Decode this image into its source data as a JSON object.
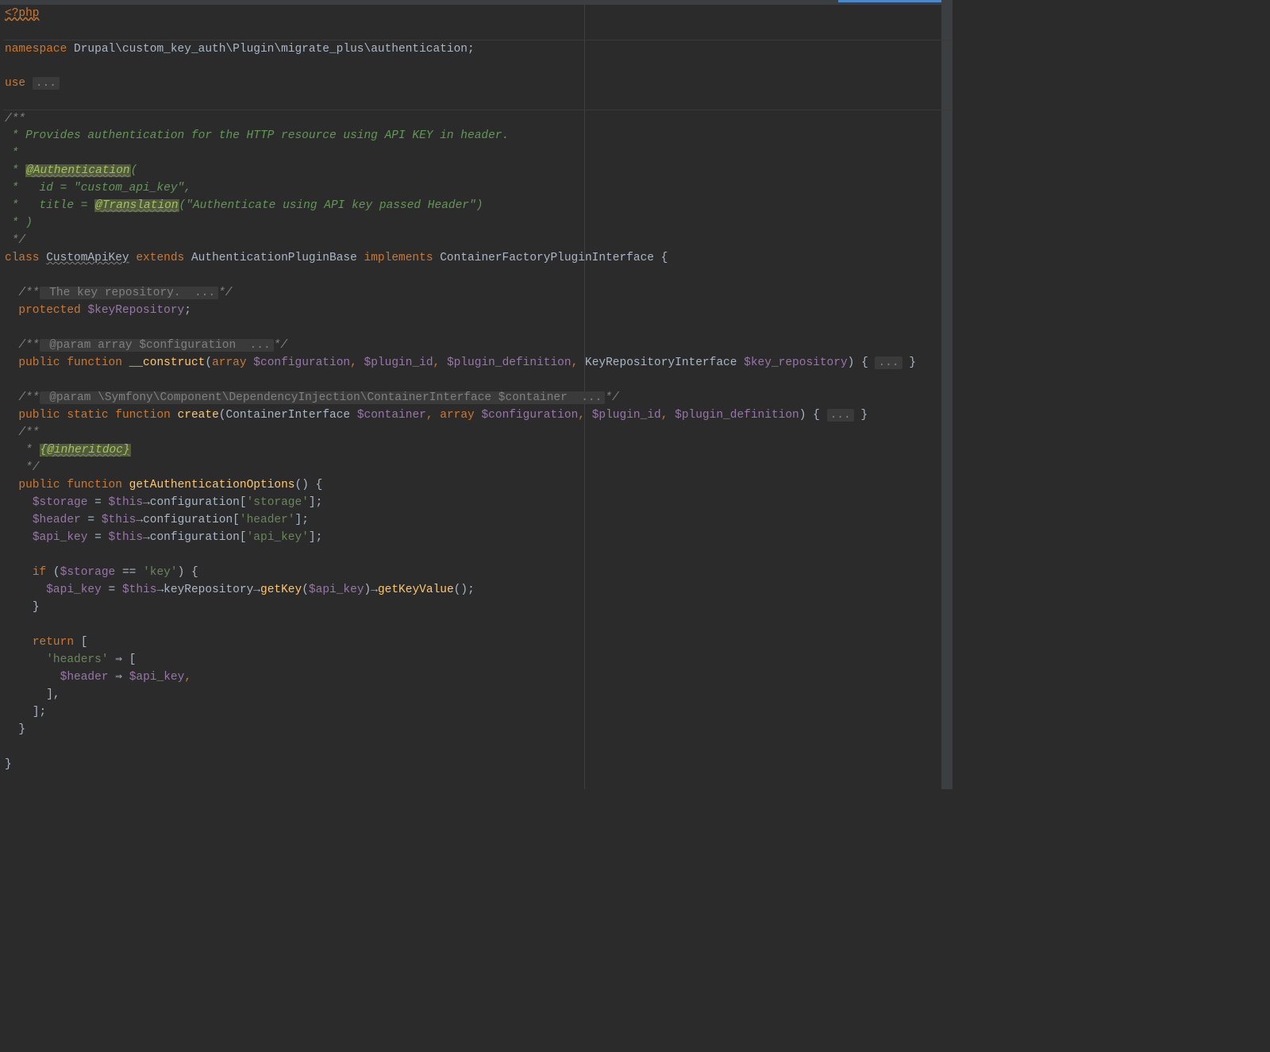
{
  "lines": {
    "l1": "<?php",
    "l2_namespace": "namespace",
    "l2_ns": " Drupal\\custom_key_auth\\Plugin\\migrate_plus\\authentication;",
    "l3_use": "use",
    "l3_dots": "...",
    "l4": "/**",
    "l5": " * Provides authentication for the HTTP resource using API KEY in header.",
    "l6": " *",
    "l7a": " * ",
    "l7b": "@Authentication",
    "l7c": "(",
    "l8a": " *   id = ",
    "l8b": "\"custom_api_key\"",
    "l8c": ",",
    "l9a": " *   title = ",
    "l9b": "@Translation",
    "l9c": "(",
    "l9d": "\"Authenticate using API key passed Header\"",
    "l9e": ")",
    "l10": " * )",
    "l11": " */",
    "l12_class": "class",
    "l12_name": "CustomApiKey",
    "l12_extends": "extends",
    "l12_base": "AuthenticationPluginBase",
    "l12_impl": "implements",
    "l12_iface": "ContainerFactoryPluginInterface {",
    "l13a": "/**",
    "l13b": " The key repository.  ...",
    "l13c": "*/",
    "l14_protected": "protected",
    "l14_var": "$keyRepository",
    "l14_semi": ";",
    "l15a": "/**",
    "l15b": " @param array $configuration  ...",
    "l15c": "*/",
    "l16_public": "public",
    "l16_function": "function",
    "l16_name": "__construct",
    "l16_p1": "(",
    "l16_array": "array",
    "l16_v1": "$configuration",
    "l16_c1": ",",
    "l16_v2": "$plugin_id",
    "l16_c2": ",",
    "l16_v3": "$plugin_definition",
    "l16_c3": ",",
    "l16_t4": "KeyRepositoryInterface",
    "l16_v4": "$key_repository",
    "l16_p2": ") {",
    "l16_dots": "...",
    "l16_close": "}",
    "l17a": "/**",
    "l17b": " @param \\Symfony\\Component\\DependencyInjection\\ContainerInterface $container  ...",
    "l17c": "*/",
    "l18_public": "public",
    "l18_static": "static",
    "l18_function": "function",
    "l18_name": "create",
    "l18_p1": "(ContainerInterface",
    "l18_v1": "$container",
    "l18_c1": ",",
    "l18_array": "array",
    "l18_v2": "$configuration",
    "l18_c2": ",",
    "l18_v3": "$plugin_id",
    "l18_c3": ",",
    "l18_v4": "$plugin_definition",
    "l18_p2": ") {",
    "l18_dots": "...",
    "l18_close": "}",
    "l19": "/**",
    "l20a": " * ",
    "l20b": "{@inheritdoc}",
    "l21": " */",
    "l22_public": "public",
    "l22_function": "function",
    "l22_name": "getAuthenticationOptions",
    "l22_rest": "() {",
    "l23_var": "$storage",
    "l23_eq": " = ",
    "l23_this": "$this",
    "l23_arrow": "→",
    "l23_prop": "configuration[",
    "l23_key": "'storage'",
    "l23_close": "];",
    "l24_var": "$header",
    "l24_key": "'header'",
    "l25_var": "$api_key",
    "l25_key": "'api_key'",
    "l27_if": "if",
    "l27_p1": " (",
    "l27_var": "$storage",
    "l27_eq": " == ",
    "l27_str": "'key'",
    "l27_p2": ") {",
    "l28_var": "$api_key",
    "l28_eq": " = ",
    "l28_this": "$this",
    "l28_arrow": "→",
    "l28_m1": "keyRepository",
    "l28_arrow2": "→",
    "l28_m2": "getKey",
    "l28_p1": "(",
    "l28_arg": "$api_key",
    "l28_p2": ")",
    "l28_arrow3": "→",
    "l28_m3": "getKeyValue",
    "l28_p3": "();",
    "l29_close": "}",
    "l31_return": "return",
    "l31_open": " [",
    "l32_key": "'headers'",
    "l32_arrow": " ⇒ [",
    "l33_var": "$header",
    "l33_arrow": " ⇒ ",
    "l33_val": "$api_key",
    "l33_c": ",",
    "l34": "],",
    "l35": "];",
    "l36": "}",
    "l38": "}",
    "indent1": "  ",
    "indent2": "    ",
    "indent3": "      ",
    "indent4": "        "
  }
}
